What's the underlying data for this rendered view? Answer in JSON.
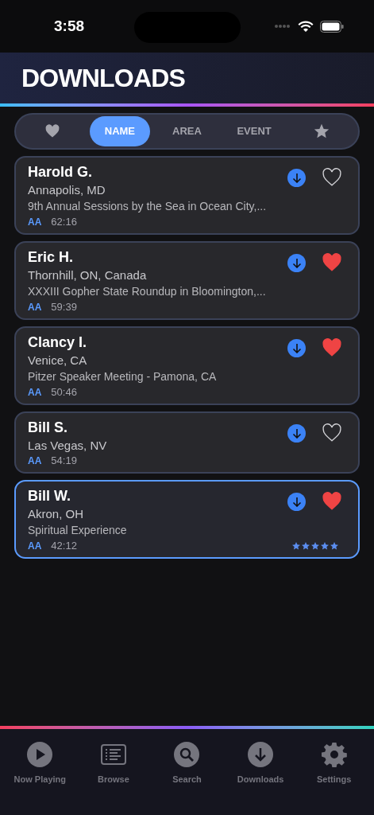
{
  "status_bar": {
    "time": "3:58"
  },
  "header": {
    "title": "DOWNLOADS"
  },
  "sort_tabs": [
    {
      "kind": "heart",
      "selected": false
    },
    {
      "kind": "text",
      "label": "NAME",
      "selected": true
    },
    {
      "kind": "text",
      "label": "AREA",
      "selected": false
    },
    {
      "kind": "text",
      "label": "EVENT",
      "selected": false
    },
    {
      "kind": "star",
      "selected": false
    }
  ],
  "downloads": [
    {
      "name": "Harold G.",
      "location": "Annapolis, MD",
      "event": "9th Annual Sessions by the Sea in Ocean City,...",
      "badge": "AA",
      "duration": "62:16",
      "favorite": false,
      "selected": false
    },
    {
      "name": "Eric H.",
      "location": "Thornhill, ON, Canada",
      "event": "XXXIII Gopher State Roundup in Bloomington,...",
      "badge": "AA",
      "duration": "59:39",
      "favorite": true,
      "selected": false
    },
    {
      "name": "Clancy I.",
      "location": "Venice, CA",
      "event": "Pitzer Speaker Meeting - Pamona, CA",
      "badge": "AA",
      "duration": "50:46",
      "favorite": true,
      "selected": false
    },
    {
      "name": "Bill S.",
      "location": "Las Vegas, NV",
      "badge": "AA",
      "duration": "54:19",
      "favorite": false,
      "selected": false
    },
    {
      "name": "Bill W.",
      "location": "Akron, OH",
      "event": "Spiritual Experience",
      "badge": "AA",
      "duration": "42:12",
      "favorite": true,
      "selected": true,
      "stars": 5
    }
  ],
  "tab_bar": [
    {
      "kind": "play",
      "label": "Now Playing",
      "selected": false
    },
    {
      "kind": "list",
      "label": "Browse",
      "selected": false
    },
    {
      "kind": "search",
      "label": "Search",
      "selected": false
    },
    {
      "kind": "download",
      "label": "Downloads",
      "selected": false
    },
    {
      "kind": "gear",
      "label": "Settings",
      "selected": false
    }
  ]
}
